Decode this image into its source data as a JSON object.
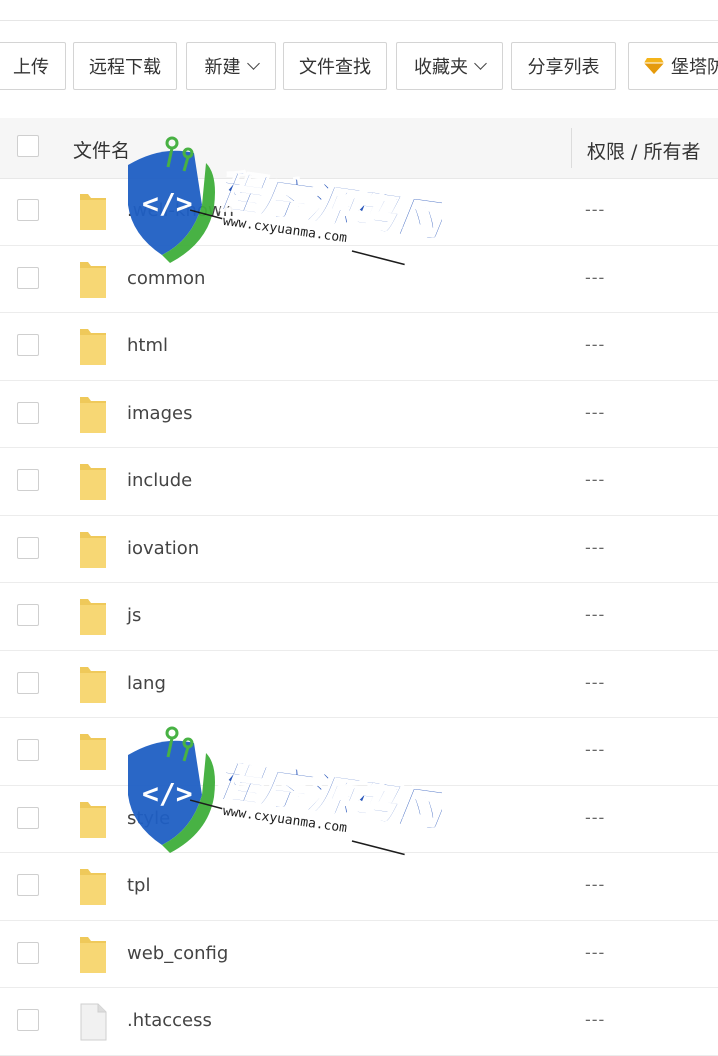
{
  "toolbar": {
    "upload": "上传",
    "remote_download": "远程下载",
    "new": "新建",
    "file_search": "文件查找",
    "favorites": "收藏夹",
    "share_list": "分享列表",
    "baota": "堡塔防"
  },
  "table": {
    "col_name": "文件名",
    "col_perm": "权限 / 所有者",
    "rows": [
      {
        "name": ".well-known",
        "perm": "---",
        "type": "folder"
      },
      {
        "name": "common",
        "perm": "---",
        "type": "folder"
      },
      {
        "name": "html",
        "perm": "---",
        "type": "folder"
      },
      {
        "name": "images",
        "perm": "---",
        "type": "folder"
      },
      {
        "name": "include",
        "perm": "---",
        "type": "folder"
      },
      {
        "name": "iovation",
        "perm": "---",
        "type": "folder"
      },
      {
        "name": "js",
        "perm": "---",
        "type": "folder"
      },
      {
        "name": "lang",
        "perm": "---",
        "type": "folder"
      },
      {
        "name": "",
        "perm": "---",
        "type": "folder"
      },
      {
        "name": "style",
        "perm": "---",
        "type": "folder"
      },
      {
        "name": "tpl",
        "perm": "---",
        "type": "folder"
      },
      {
        "name": "web_config",
        "perm": "---",
        "type": "folder"
      },
      {
        "name": ".htaccess",
        "perm": "---",
        "type": "file"
      }
    ]
  },
  "watermark": {
    "title": "程序源码网",
    "url": "www.cxyuanma.com"
  },
  "colors": {
    "folder": "#f7d774",
    "folder_dark": "#efc95a",
    "header_bg": "#f6f6f6",
    "border": "#d4d4d4",
    "wm_blue": "#1f4fb8",
    "wm_green": "#3fae3a"
  }
}
